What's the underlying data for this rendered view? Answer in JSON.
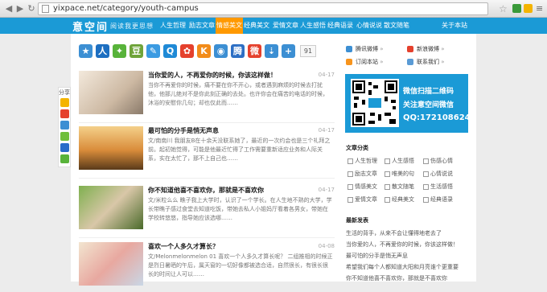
{
  "browser": {
    "url": "yixpace.net/category/youth-campus"
  },
  "site": {
    "logo": "意空间",
    "slogan": "阅读我更思想",
    "nav": [
      {
        "label": "人生哲理",
        "active": false
      },
      {
        "label": "励志文章",
        "active": false
      },
      {
        "label": "情感美文",
        "active": true
      },
      {
        "label": "经典美文",
        "active": false
      },
      {
        "label": "爱情文章",
        "active": false
      },
      {
        "label": "人生感悟",
        "active": false
      },
      {
        "label": "经典语录",
        "active": false
      },
      {
        "label": "心情说说",
        "active": false
      },
      {
        "label": "散文随笔",
        "active": false
      },
      {
        "label": "关于本站",
        "active": false
      }
    ]
  },
  "share": {
    "float_label": "分享",
    "count": "91",
    "icons": [
      "qzone-icon",
      "renren-icon",
      "favorite-icon",
      "douban-icon",
      "pen-icon",
      "qq-icon",
      "baidu-icon",
      "kaixin-icon",
      "camera-icon",
      "tqq-icon",
      "weibo-icon",
      "bookmark-icon",
      "plus-icon"
    ]
  },
  "posts": [
    {
      "title": "当你爱的人，不再爱你的时候，你该这样做！",
      "date": "04-17",
      "excerpt": "当你不再爱你的时候，痛不要在你不开心，或者遇到麻烦的时候去打扰他，他那儿绝对不是你此刻正确的去处。也许你会在痛苦的电话的时候，沐浴的安慰你几句；却也仅此而……"
    },
    {
      "title": "最可怕的分手是悄无声息",
      "date": "04-17",
      "excerpt": "文/南南川 我朋友B在十余天没联系她了，最近的一次约会也是三个礼拜之前。起初她觉得，可能是他最近忙得了工作需要重新适应业务和人际关系，实在太忙了，那不上自己也……"
    },
    {
      "title": "你不知道他喜不喜欢你，那就是不喜欢你",
      "date": "04-17",
      "excerpt": "文/米粒么么 瞧子我上大学时，认识了一个学长。在人生地不熟的大学，学长带瞧子感过食堂去知道吃饭，带她去私人小姐妈厅看着各男女，带她在学校转悠悠，指导她应该选哪……"
    },
    {
      "title": "喜欢一个人多久才算长？",
      "date": "04-08",
      "excerpt": "文/Melonmelonmelon 01 喜欢一个人多久才算长呢？ 二组推相的时候正是烈日暑晒的午后，属天窗的一切好像都被选合适，自然很长，有很长很长的时间让人可以……"
    }
  ],
  "sidebar": {
    "links": [
      {
        "label": "腾讯微博",
        "arrow": "»"
      },
      {
        "label": "新浪微博",
        "arrow": "»"
      },
      {
        "label": "订阅本站",
        "arrow": "»"
      },
      {
        "label": "联系我们",
        "arrow": "»"
      }
    ],
    "promo": {
      "line1": "微信扫描二维码",
      "line2": "关注意空间微信",
      "line3": "QQ:172108624"
    },
    "category_title": "文章分类",
    "categories": [
      "人生哲理",
      "人生感悟",
      "伤感心情",
      "励志文章",
      "唯美的句",
      "心情说说",
      "情感美文",
      "散文随笔",
      "生活感悟",
      "爱情文章",
      "经典美文",
      "经典语录"
    ],
    "recent_title": "最新发表",
    "recent": [
      "生活的背手，从来不会让懂得地老去了",
      "当你爱的人，不再爱你的时候，你该这样做！",
      "最可怕的分手是悄无声息",
      "希望我们每个人都知道大阳和月亮谁个更重要",
      "你不知道他喜不喜欢你，那就是不喜欢你"
    ]
  },
  "colors": {
    "brand_blue": "#1b9ad6",
    "nav_active": "#ff9900"
  }
}
